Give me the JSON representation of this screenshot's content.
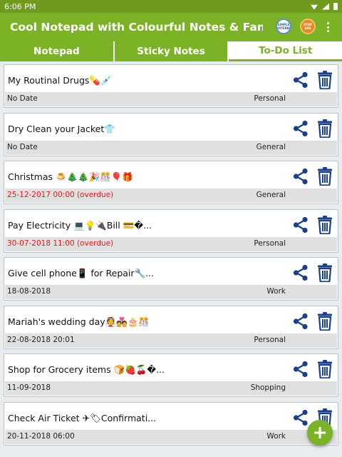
{
  "status_bar": {
    "time": "6:06 PM"
  },
  "app_bar": {
    "title": "Cool Notepad with Colourful Notes & Fancy Font...",
    "badge_one_text": "SIMPLE NOTEPAD",
    "badge_two_text": "STOP ADS"
  },
  "tabs": [
    {
      "label": "Notepad",
      "active": false
    },
    {
      "label": "Sticky Notes",
      "active": false
    },
    {
      "label": "To-Do List",
      "active": true
    }
  ],
  "colors": {
    "primary": "#7cb326",
    "status_bar": "#6f9a1e",
    "overdue": "#e21a1a",
    "icon": "#1a3f8f"
  },
  "icons": {
    "share": "share-icon",
    "delete": "trash-icon",
    "add": "plus-icon"
  },
  "todos": [
    {
      "title": "My Routinal Drugs💊💉",
      "date": "No Date",
      "category": "Personal",
      "overdue": false
    },
    {
      "title": "Dry Clean your Jacket👕",
      "date": "No Date",
      "category": "General",
      "overdue": false
    },
    {
      "title": "Christmas 🍮🎄🎄🎉🎊🎈🎁",
      "date": "25-12-2017 00:00 (overdue)",
      "category": "General",
      "overdue": true
    },
    {
      "title": "Pay Electricity 💻💡🔌Bill 💳�...",
      "date": "30-07-2018 11:00 (overdue)",
      "category": "Personal",
      "overdue": true
    },
    {
      "title": "Give cell phone📱 for Repair🔧...",
      "date": "18-08-2018",
      "category": "Work",
      "overdue": false
    },
    {
      "title": "Mariah's wedding day👰💑🎂🎊",
      "date": "22-08-2018 20:01",
      "category": "Personal",
      "overdue": false
    },
    {
      "title": "Shop for Grocery items 🍞🍓🍒�...",
      "date": "11-09-2018",
      "category": "Shopping",
      "overdue": false
    },
    {
      "title": "Check Air Ticket ✈🏷Confirmati...",
      "date": "20-11-2018 06:00",
      "category": "Work",
      "overdue": false
    }
  ]
}
